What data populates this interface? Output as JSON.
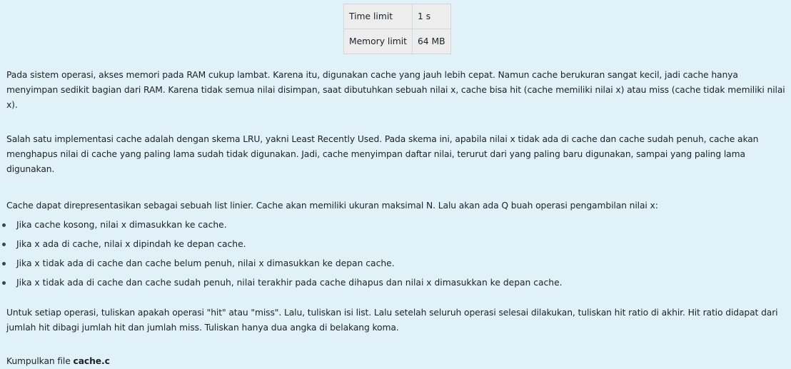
{
  "limits": {
    "time_label": "Time limit",
    "time_value": "1 s",
    "memory_label": "Memory limit",
    "memory_value": "64 MB"
  },
  "paragraphs": {
    "p1": "Pada sistem operasi, akses memori pada RAM cukup lambat. Karena itu, digunakan cache yang jauh lebih cepat. Namun cache berukuran sangat kecil, jadi cache hanya menyimpan sedikit bagian dari RAM. Karena tidak semua nilai disimpan, saat dibutuhkan sebuah nilai x, cache bisa hit (cache memiliki nilai x) atau miss (cache tidak memiliki nilai x).",
    "p2": "Salah satu implementasi cache adalah dengan skema LRU, yakni Least Recently Used. Pada skema ini, apabila nilai x tidak ada di cache dan cache sudah penuh, cache akan menghapus nilai di cache yang paling lama sudah tidak digunakan. Jadi, cache menyimpan daftar nilai, terurut dari yang paling baru digunakan, sampai yang paling lama digunakan.",
    "p3": "Cache dapat direpresentasikan sebagai sebuah list linier. Cache akan memiliki ukuran maksimal N. Lalu akan ada Q buah operasi pengambilan nilai x:",
    "bullets": [
      "Jika cache kosong, nilai x dimasukkan ke cache.",
      "Jika x ada di cache, nilai x dipindah ke depan cache.",
      "Jika x tidak ada di cache dan cache belum penuh, nilai x dimasukkan ke depan cache.",
      "Jika x tidak ada di cache dan cache sudah penuh, nilai terakhir pada cache dihapus dan nilai x dimasukkan ke depan cache."
    ],
    "p4": "Untuk setiap operasi, tuliskan apakah operasi \"hit\" atau \"miss\". Lalu, tuliskan isi list. Lalu setelah seluruh operasi selesai dilakukan, tuliskan hit ratio di akhir. Hit ratio didapat dari jumlah hit dibagi jumlah hit dan jumlah miss. Tuliskan hanya dua angka di belakang koma.",
    "p5_prefix": "Kumpulkan file ",
    "p5_filename": "cache.c"
  }
}
